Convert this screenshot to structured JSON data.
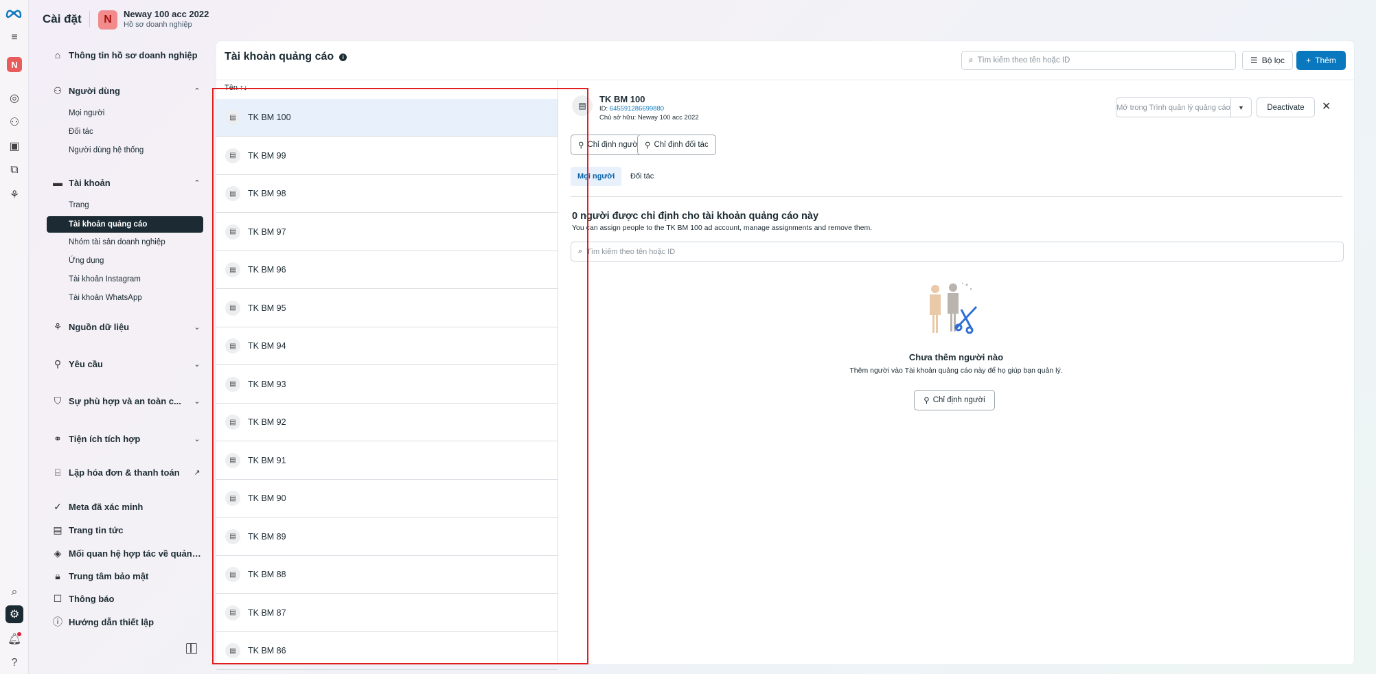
{
  "app": {
    "title": "Cài đặt"
  },
  "account": {
    "initial": "N",
    "name": "Neway 100 acc 2022",
    "subtitle": "Hồ sơ doanh nghiệp"
  },
  "rail": {
    "avatar_initial": "N",
    "icons": [
      "meta-logo-icon",
      "menu-icon",
      "compass-icon",
      "people-icon",
      "pages-icon",
      "catalog-icon",
      "integrations-icon",
      "search-icon",
      "gear-icon",
      "bell-icon",
      "help-icon"
    ]
  },
  "sidebar": {
    "business_info": "Thông tin hồ sơ doanh nghiệp",
    "users": {
      "label": "Người dùng",
      "items": [
        "Mọi người",
        "Đối tác",
        "Người dùng hệ thống"
      ]
    },
    "accounts": {
      "label": "Tài khoản",
      "items": [
        "Trang",
        "Tài khoản quảng cáo",
        "Nhóm tài sản doanh nghiệp",
        "Ứng dụng",
        "Tài khoản Instagram",
        "Tài khoản WhatsApp"
      ]
    },
    "data_sources": "Nguồn dữ liệu",
    "requests": "Yêu cầu",
    "compliance": "Sự phù hợp và an toàn c...",
    "integrations": "Tiện ích tích hợp",
    "billing": "Lập hóa đơn & thanh toán",
    "verified": "Meta đã xác minh",
    "news": "Trang tin tức",
    "partnerships": "Mối quan hệ hợp tác về quảng ...",
    "security": "Trung tâm bảo mật",
    "notifications": "Thông báo",
    "setup_guide": "Hướng dẫn thiết lập"
  },
  "main": {
    "title": "Tài khoản quảng cáo",
    "search_placeholder": "Tìm kiếm theo tên hoặc ID",
    "filter_label": "Bộ lọc",
    "add_label": "Thêm",
    "list_header": "Tên ↑↓",
    "rows": [
      "TK BM 100",
      "TK BM 99",
      "TK BM 98",
      "TK BM 97",
      "TK BM 96",
      "TK BM 95",
      "TK BM 94",
      "TK BM 93",
      "TK BM 92",
      "TK BM 91",
      "TK BM 90",
      "TK BM 89",
      "TK BM 88",
      "TK BM 87",
      "TK BM 86"
    ]
  },
  "detail": {
    "name": "TK BM 100",
    "id_label": "ID: ",
    "id_value": "645591286699880",
    "owner": "Chủ sở hữu: Neway 100 acc 2022",
    "open_in_manager": "Mở trong Trình quản lý quảng cáo",
    "deactivate": "Deactivate",
    "assign_people": "Chỉ định người",
    "assign_partner": "Chỉ định đối tác",
    "tabs": [
      "Mọi người",
      "Đối tác"
    ],
    "section_title": "0 người được chỉ định cho tài khoản quảng cáo này",
    "section_desc": "You can assign people to the TK BM 100 ad account, manage assignments and remove them.",
    "search_placeholder": "Tìm kiếm theo tên hoặc ID",
    "empty_title": "Chưa thêm người nào",
    "empty_desc": "Thêm người vào Tài khoản quảng cáo này để họ giúp bạn quản lý.",
    "empty_button": "Chỉ định người"
  },
  "colors": {
    "accent": "#0a78be",
    "highlight_box": "#e11d1d",
    "selected_row": "#e7f0fb"
  }
}
